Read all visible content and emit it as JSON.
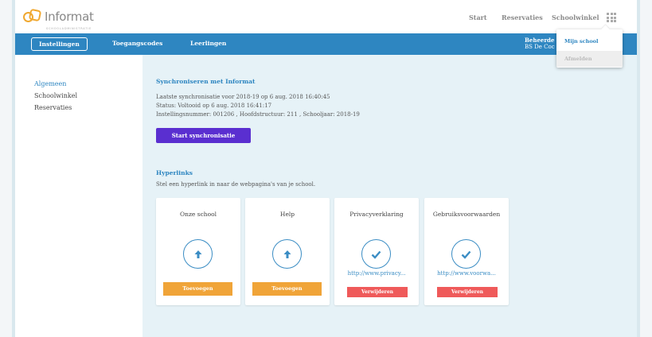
{
  "brand": {
    "name": "Informat",
    "tagline": "SCHOOLADMINISTRATIE"
  },
  "topnav": {
    "start": "Start",
    "reservaties": "Reservaties",
    "schoolwinkel": "Schoolwinkel"
  },
  "tabs": {
    "instellingen": "Instellingen",
    "toegangscodes": "Toegangscodes",
    "leerlingen": "Leerlingen"
  },
  "user": {
    "name": "Beheerde",
    "school": "BS De Coc"
  },
  "dropdown": {
    "mijn_school": "Mijn school",
    "afmelden": "Afmelden"
  },
  "sidebar": {
    "items": [
      "Algemeen",
      "Schoolwinkel",
      "Reservaties"
    ]
  },
  "sync": {
    "title": "Synchroniseren met Informat",
    "last": "Laatste synchronisatie voor 2018-19 op 6 aug. 2018 16:40:45",
    "status": "Status: Voltooid op 6 aug. 2018 16:41:17",
    "info": "Instellingsnummer: 001206 , Hoofdstructuur: 211 , Schooljaar: 2018-19",
    "button": "Start synchronisatie"
  },
  "hyperlinks": {
    "title": "Hyperlinks",
    "subtitle": "Stel een hyperlink in naar de webpagina's van je school.",
    "cards": [
      {
        "title": "Onze school",
        "icon": "arrow-up-icon",
        "action": "Toevoegen"
      },
      {
        "title": "Help",
        "icon": "arrow-up-icon",
        "action": "Toevoegen"
      },
      {
        "title": "Privacyverklaring",
        "icon": "check-icon",
        "link": "http://www.privacy...",
        "action": "Verwijderen"
      },
      {
        "title": "Gebruiksvoorwaarden",
        "icon": "check-icon",
        "link": "http://www.voorwa...",
        "action": "Verwijderen"
      }
    ]
  },
  "colors": {
    "primary": "#2e86c1",
    "add": "#f0a438",
    "delete": "#ef5a5a",
    "sync": "#5a2fd0",
    "logo": "#f0a830"
  }
}
